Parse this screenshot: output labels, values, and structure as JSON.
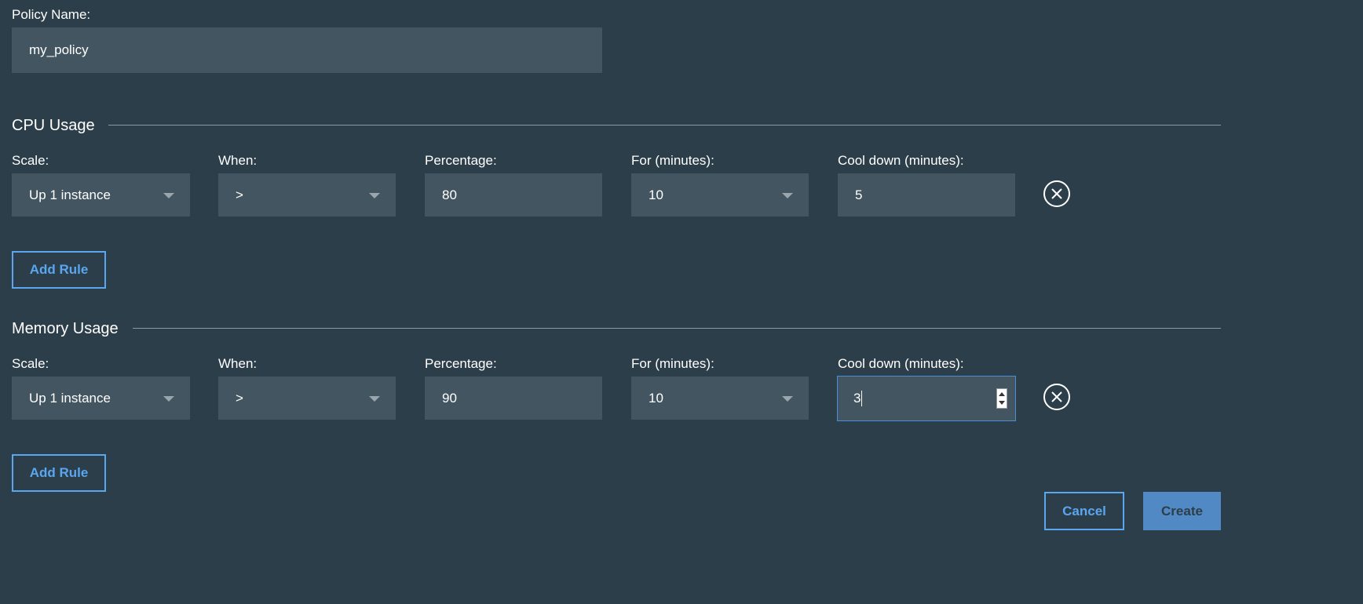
{
  "policy": {
    "name_label": "Policy Name:",
    "name_value": "my_policy"
  },
  "labels": {
    "scale": "Scale:",
    "when": "When:",
    "percentage": "Percentage:",
    "for_minutes": "For (minutes):",
    "cool_down": "Cool down (minutes):"
  },
  "cpu": {
    "title": "CPU Usage",
    "rule": {
      "scale": "Up 1 instance",
      "when": ">",
      "percentage": "80",
      "for_minutes": "10",
      "cool_down": "5"
    },
    "add_rule_label": "Add Rule"
  },
  "memory": {
    "title": "Memory Usage",
    "rule": {
      "scale": "Up 1 instance",
      "when": ">",
      "percentage": "90",
      "for_minutes": "10",
      "cool_down": "3"
    },
    "add_rule_label": "Add Rule"
  },
  "actions": {
    "cancel_label": "Cancel",
    "create_label": "Create"
  },
  "icons": {
    "remove": "close-circle-icon",
    "dropdown": "chevron-down-icon"
  },
  "colors": {
    "background": "#2c3e4a",
    "field": "#425560",
    "accent": "#5aa6ef",
    "primary_button": "#5189c4"
  }
}
